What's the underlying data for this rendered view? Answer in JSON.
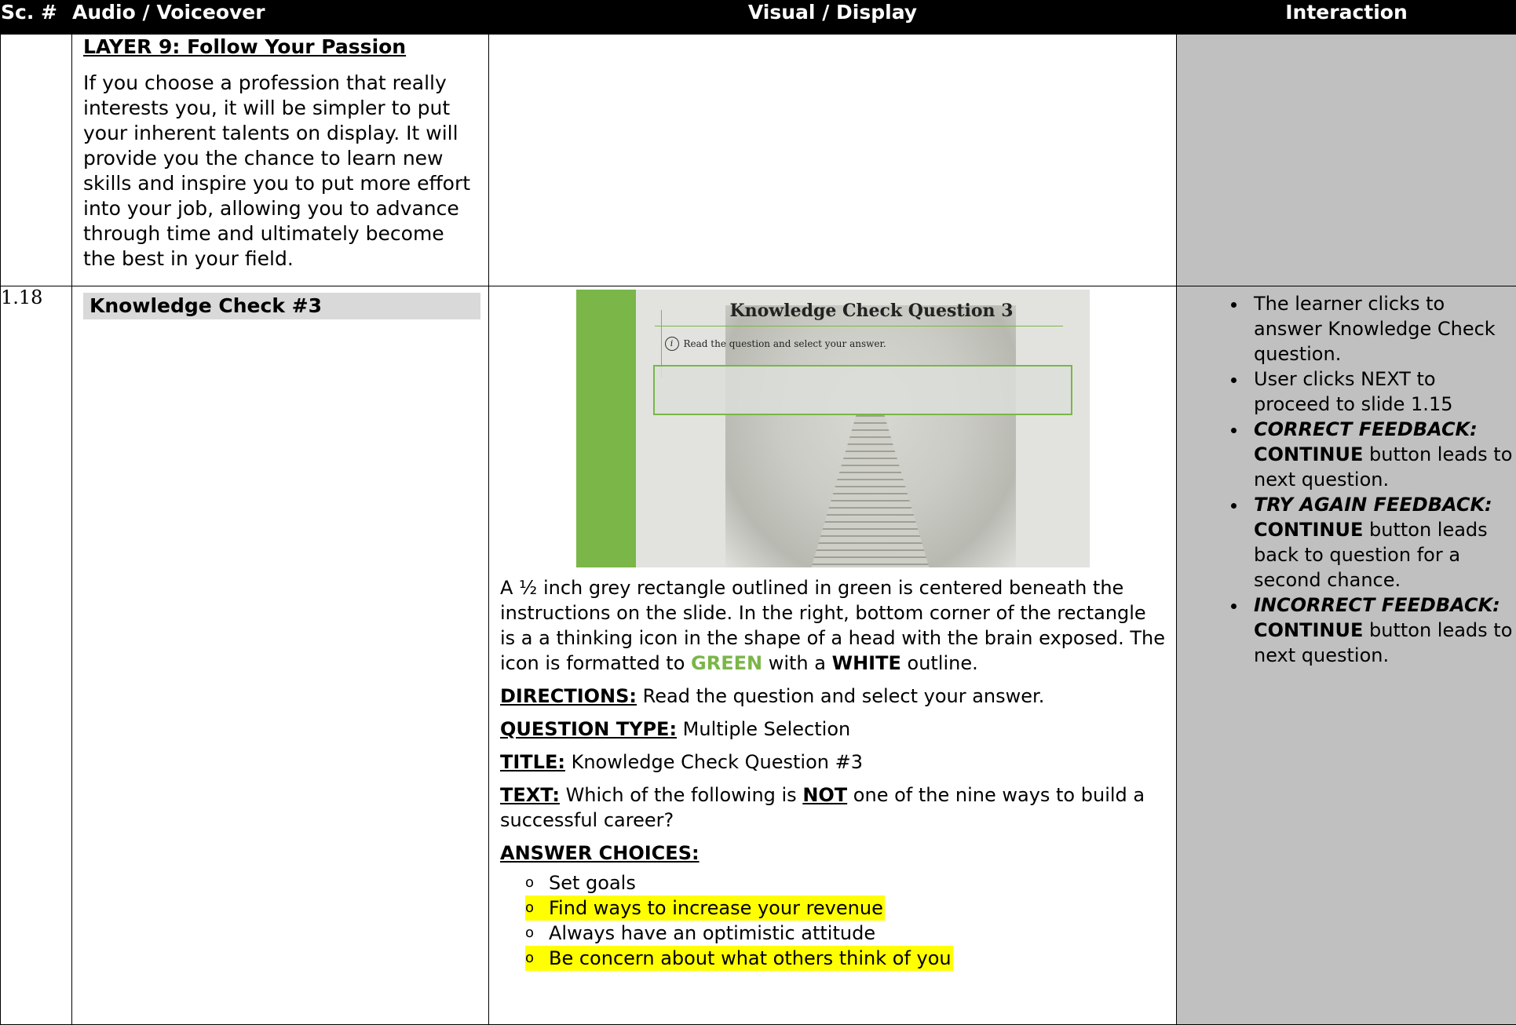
{
  "header": {
    "col1": "Sc. #",
    "col2": "Audio / Voiceover",
    "col3": "Visual / Display",
    "col4": "Interaction"
  },
  "row1": {
    "heading": "LAYER 9: Follow Your Passion",
    "body": "If you choose a profession that really interests you, it will be simpler to put your inherent talents on display. It will provide you the chance to learn new skills and inspire you to put more effort into your job, allowing you to advance through time and ultimately become the best in your field."
  },
  "row2": {
    "scene_number": "1.18",
    "audio_title": "Knowledge Check #3",
    "slide": {
      "title": "Knowledge Check Question 3",
      "info_icon_glyph": "i",
      "instruction": "Read the question and select your answer."
    },
    "description": {
      "text_before_green": "A ½ inch grey rectangle outlined in green is centered beneath the instructions on the slide. In the right, bottom corner of the rectangle is a a thinking icon in the shape of a head with the brain exposed. The icon is formatted to ",
      "green_word": "GREEN",
      "text_between": " with a ",
      "white_word": "WHITE",
      "text_after": " outline."
    },
    "directions": {
      "label": "DIRECTIONS:",
      "value": " Read the question and select your answer."
    },
    "question_type": {
      "label": "QUESTION TYPE:",
      "value": " Multiple Selection"
    },
    "title_field": {
      "label": "TITLE:",
      "value": " Knowledge Check Question #3"
    },
    "text_field": {
      "label": "TEXT:",
      "value_before": " Which of the following is ",
      "emphasis": "NOT",
      "value_after": " one of the nine ways to build a successful career?"
    },
    "answer_choices_label": "ANSWER CHOICES:",
    "choice_marker": "o",
    "answer_choices": [
      {
        "text": "Set goals",
        "highlighted": false
      },
      {
        "text": "Find ways to increase your revenue",
        "highlighted": true
      },
      {
        "text": "Always have an optimistic attitude",
        "highlighted": false
      },
      {
        "text": "Be concern about what others think of you",
        "highlighted": true
      }
    ],
    "interaction": {
      "item1": "The learner clicks to answer Knowledge Check question.",
      "item2": "User clicks NEXT to proceed to slide 1.15",
      "item3_label": "CORRECT FEEDBACK:",
      "item3_bold": "CONTINUE",
      "item3_rest": " button leads to next question.",
      "item4_label": "TRY AGAIN FEEDBACK:",
      "item4_bold": "CONTINUE",
      "item4_rest": " button leads back to question for a second chance.",
      "item5_label": "INCORRECT FEEDBACK:",
      "item5_bold": "CONTINUE",
      "item5_rest": " button leads to next question."
    }
  },
  "colors": {
    "header_bg": "#000000",
    "grey_cell": "#c0c0c0",
    "green_accent": "#7ab648",
    "highlight": "#ffff00"
  }
}
